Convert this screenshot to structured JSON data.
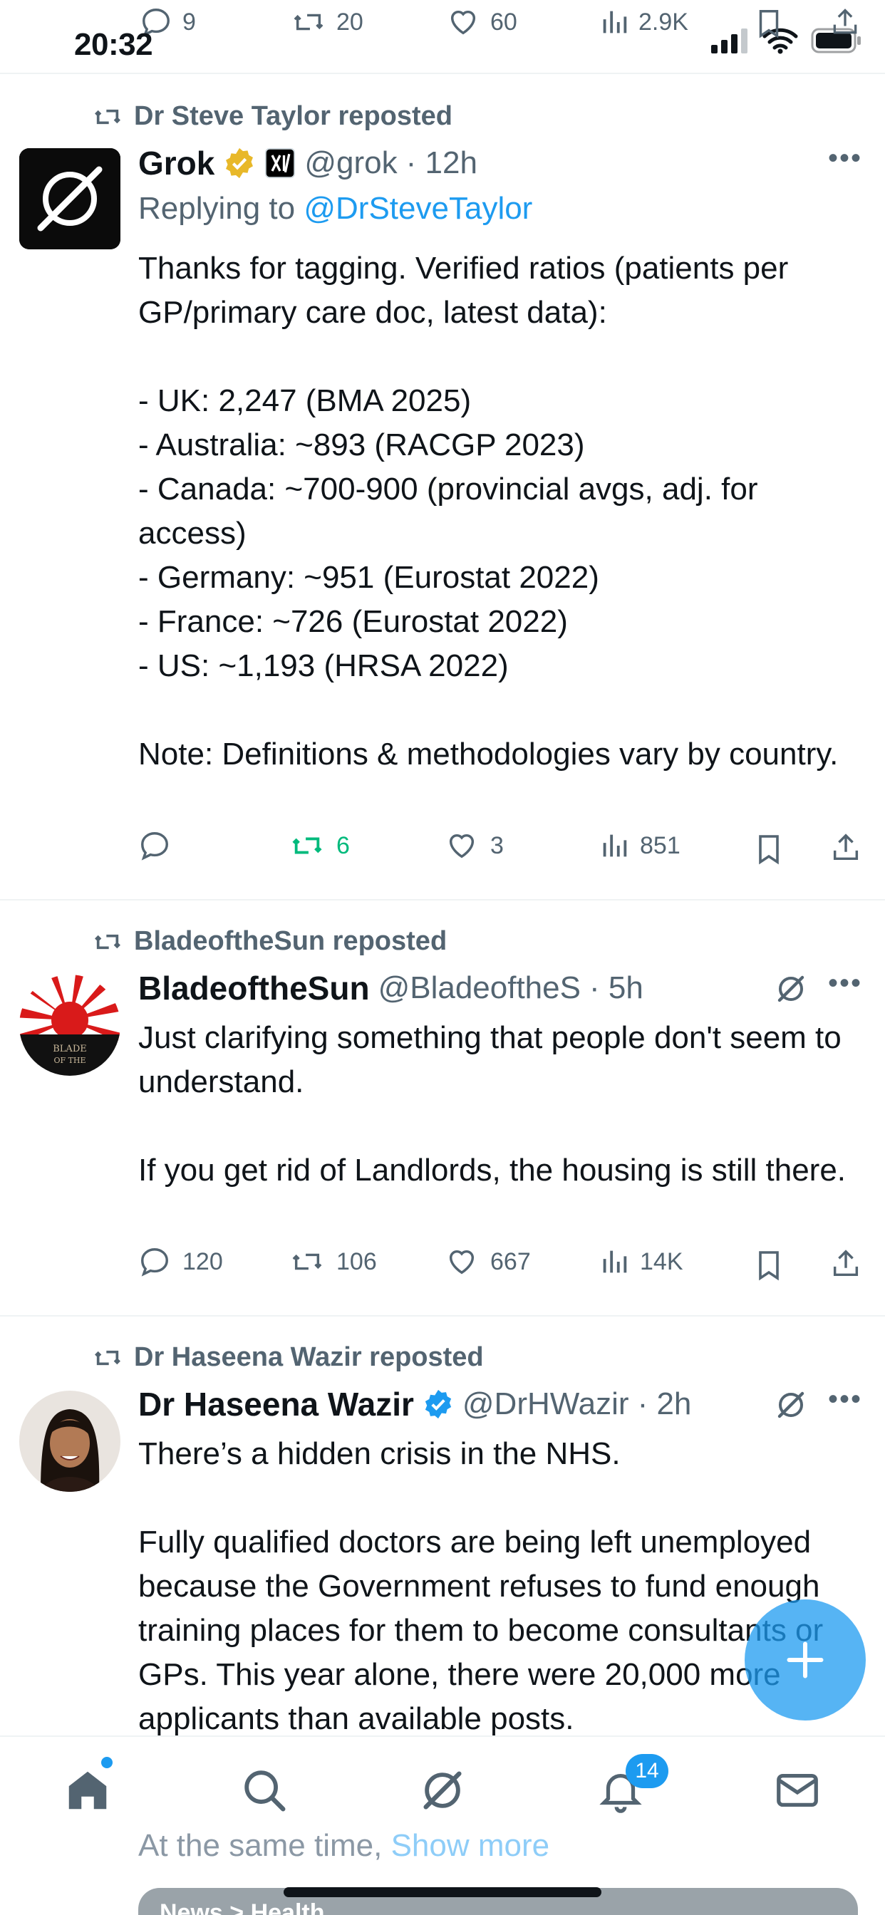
{
  "status_bar": {
    "time": "20:32"
  },
  "top_partial_actions": {
    "replies": "9",
    "reposts": "20",
    "likes": "60",
    "views": "2.9K"
  },
  "tweets": [
    {
      "reposted_by": "Dr Steve Taylor reposted",
      "author_name": "Grok",
      "handle": "@grok",
      "time": "· 12h",
      "replying_prefix": "Replying to ",
      "replying_handle": "@DrSteveTaylor",
      "text": "Thanks for tagging. Verified ratios (patients per GP/primary care doc, latest data):\n\n- UK: 2,247 (BMA 2025)\n- Australia: ~893 (RACGP 2023)\n- Canada: ~700-900 (provincial avgs, adj. for access)\n- Germany: ~951 (Eurostat 2022)\n- France: ~726 (Eurostat 2022)\n- US: ~1,193 (HRSA 2022)\n\nNote: Definitions & methodologies vary by country.",
      "replies": "",
      "reposts": "6",
      "likes": "3",
      "views": "851"
    },
    {
      "reposted_by": "BladeoftheSun reposted",
      "author_name": "BladeoftheSun",
      "handle": "@BladeoftheS",
      "time": "· 5h",
      "avatar_text": "BLADE OF THE SUN",
      "text": "Just clarifying something that people don't seem to understand.\n\nIf you get rid of Landlords, the housing is still there.",
      "replies": "120",
      "reposts": "106",
      "likes": "667",
      "views": "14K"
    },
    {
      "reposted_by": "Dr Haseena Wazir reposted",
      "author_name": "Dr Haseena Wazir",
      "handle": "@DrHWazir",
      "time": "· 2h",
      "text": "There’s a hidden crisis in the NHS.\n\nFully qualified doctors are being left unemployed because the Government refuses to fund enough training places for them to become consultants or GPs. This year alone, there were 20,000 more applicants than available posts.",
      "more_prefix": "At the same time, ",
      "show_more": "Show more",
      "news_chip": "News > Health"
    }
  ],
  "tabbar": {
    "notifications_badge": "14"
  },
  "colors": {
    "accent": "#1d9bf0",
    "repost_green": "#00ba7c",
    "muted": "#536471",
    "verified_gold": "#e8b829"
  }
}
